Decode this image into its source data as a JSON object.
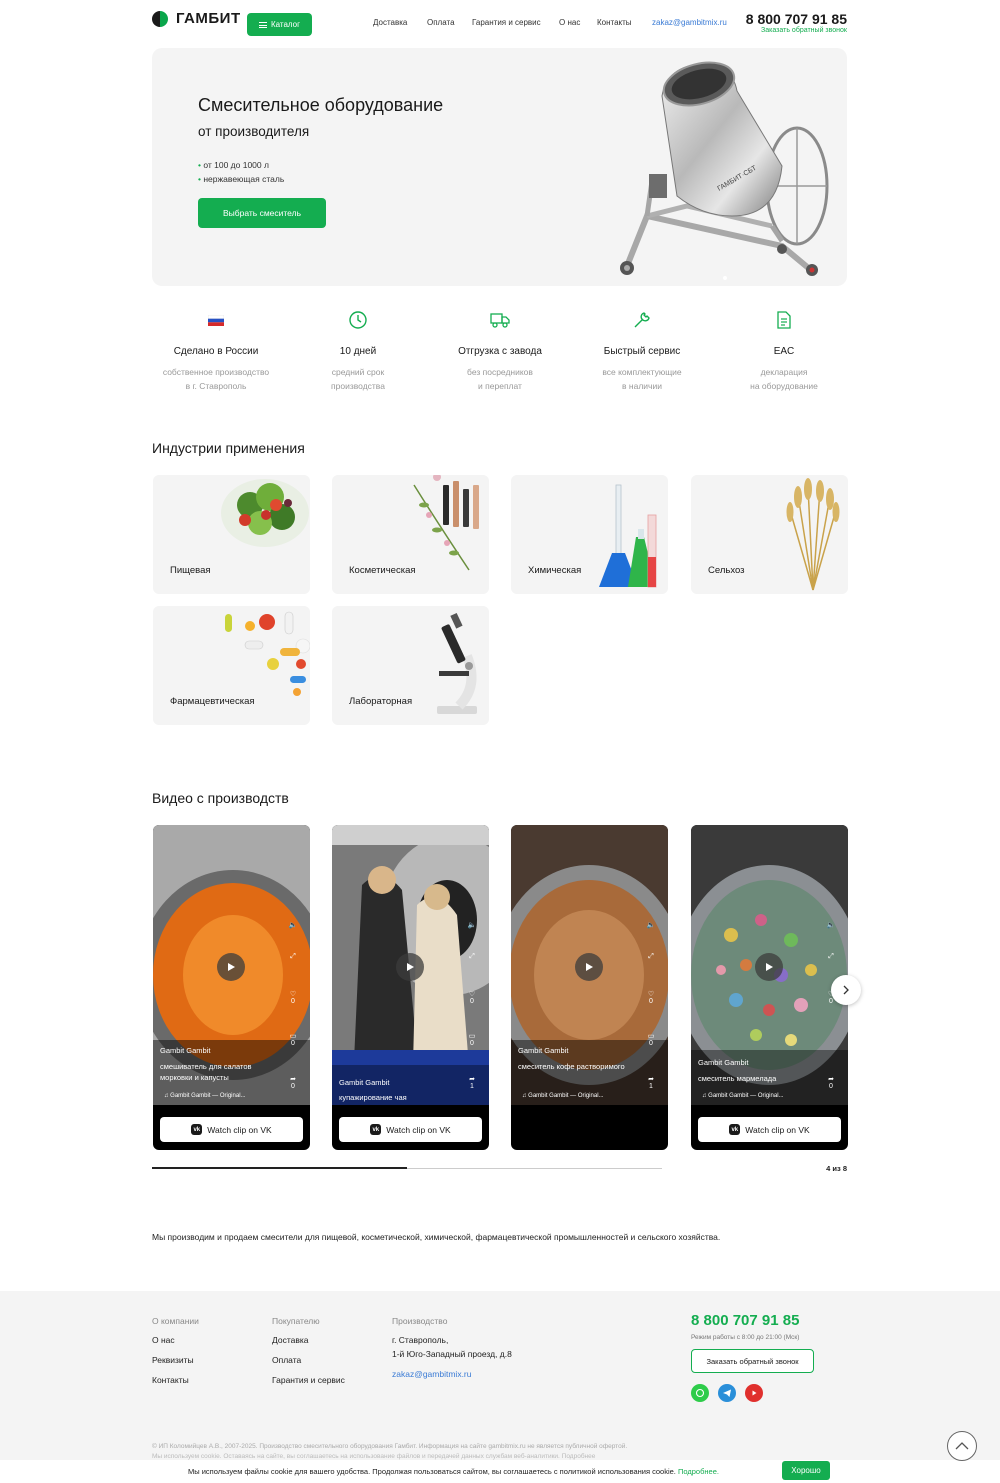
{
  "header": {
    "logo_text": "ГАМБИТ",
    "catalog_label": "Каталог",
    "nav": [
      "Доставка",
      "Оплата",
      "Гарантия и сервис",
      "О нас",
      "Контакты"
    ],
    "email": "zakaz@gambitmix.ru",
    "phone": "8 800 707 91 85",
    "callback": "Заказать обратный звонок"
  },
  "hero": {
    "title": "Смесительное оборудование",
    "subtitle": "от производителя",
    "bullets": [
      "от 100 до 1000 л",
      "нержавеющая сталь"
    ],
    "button": "Выбрать смеситель",
    "product_brand": "ГАМБИТ·СБТ"
  },
  "features": [
    {
      "icon": "russia-flag-icon",
      "title": "Сделано в России",
      "desc1": "собственное производство",
      "desc2": "в г. Ставрополь"
    },
    {
      "icon": "clock-icon",
      "title": "10 дней",
      "desc1": "средний срок",
      "desc2": "производства"
    },
    {
      "icon": "truck-icon",
      "title": "Отгрузка с завода",
      "desc1": "без посредников",
      "desc2": "и переплат"
    },
    {
      "icon": "wrench-icon",
      "title": "Быстрый сервис",
      "desc1": "все комплектующие",
      "desc2": "в наличии"
    },
    {
      "icon": "document-icon",
      "title": "EAC",
      "desc1": "декларация",
      "desc2": "на оборудование"
    }
  ],
  "industries": {
    "title": "Индустрии применения",
    "items": [
      "Пищевая",
      "Косметическая",
      "Химическая",
      "Сельхоз",
      "Фармацевтическая",
      "Лабораторная"
    ]
  },
  "videos": {
    "title": "Видео с производств",
    "watch_label": "Watch clip on VK",
    "items": [
      {
        "author": "Gambit Gambit",
        "caption": "смешиватель для салатов морковки и капусты",
        "music": "Gambit Gambit — Original...",
        "likes": "0",
        "comments": "0",
        "shares": "0"
      },
      {
        "author": "Gambit Gambit",
        "caption": "купажирование чая",
        "music": "",
        "likes": "0",
        "comments": "0",
        "shares": "1"
      },
      {
        "author": "Gambit Gambit",
        "caption": "смеситель кофе растворимого",
        "music": "Gambit Gambit — Original...",
        "likes": "0",
        "comments": "0",
        "shares": "1"
      },
      {
        "author": "Gambit Gambit",
        "caption": "смеситель мармелада",
        "music": "Gambit Gambit — Original...",
        "likes": "0",
        "comments": "",
        "shares": "0"
      }
    ],
    "counter": "4 из 8",
    "progress": 0.5
  },
  "about": "Мы производим и продаем смесители для пищевой, косметической, химической, фармацевтической промышленностей и сельского хозяйства.",
  "footer": {
    "company": {
      "heading": "О компании",
      "links": [
        "О нас",
        "Реквизиты",
        "Контакты"
      ]
    },
    "customer": {
      "heading": "Покупателю",
      "links": [
        "Доставка",
        "Оплата",
        "Гарантия и сервис"
      ]
    },
    "production": {
      "heading": "Производство",
      "address1": "г. Ставрополь,",
      "address2": "1-й Юго-Западный проезд, д.8",
      "email": "zakaz@gambitmix.ru"
    },
    "phone": "8 800 707 91 85",
    "hours": "Режим работы с 8:00 до 21:00 (Мск)",
    "callback": "Заказать обратный звонок",
    "copyright": "© ИП Коломийцев А.В., 2007-2025. Производство смесительного оборудования Гамбит. Информация на сайте gambitmix.ru не является публичной офертой.",
    "copyright2": "Мы используем cookie. Оставаясь на сайте, вы соглашаетесь на использование файлов и передачей данных службам веб-аналитики. Подробнее"
  },
  "cookie": {
    "text": "Мы используем файлы cookie для вашего удобства. Продолжая пользоваться сайтом, вы соглашаетесь с политикой использования cookie.",
    "more": "Подробнее.",
    "ok": "Хорошо"
  },
  "colors": {
    "accent": "#14ad50",
    "link": "#3a7bd5",
    "panel": "#f4f4f4"
  }
}
